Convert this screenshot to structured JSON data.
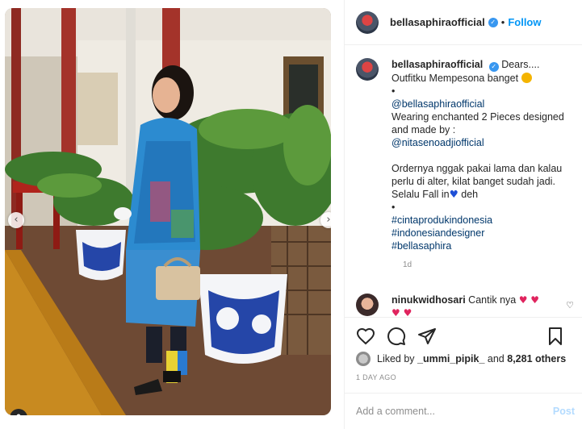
{
  "post": {
    "username": "bellasaphiraofficial",
    "follow_label": "Follow",
    "separator": "•"
  },
  "caption": {
    "username": "bellasaphiraofficial",
    "line1": "Dears....",
    "line2": "Outfitku Mempesona banget",
    "bullet1": "•",
    "mention1": "@bellasaphiraofficial",
    "line3": "Wearing enchanted 2 Pieces designed",
    "line4": "and made by :",
    "mention2": "@nitasenoadjiofficial",
    "line5": "Ordernya nggak pakai lama dan kalau",
    "line6": "perlu di alter, kilat banget sudah jadi.",
    "line7a": "Selalu Fall in",
    "line7b": " deh",
    "bullet2": "•",
    "hashtag1": "#cintaprodukindonesia",
    "hashtag2": "#indonesiandesigner",
    "hashtag3": "#bellasaphira",
    "time_ago": "1d"
  },
  "comment": {
    "username": "ninukwidhosari",
    "text": "Cantik nya"
  },
  "likes": {
    "prefix": "Liked by",
    "liker": "_ummi_pipik_",
    "middle": "and",
    "count": "8,281 others"
  },
  "posted_date": "1 DAY AGO",
  "comment_box": {
    "placeholder": "Add a comment...",
    "post_label": "Post"
  },
  "icons": {
    "verified": "verified-badge-icon",
    "heart": "heart-icon",
    "comment": "comment-icon",
    "share": "share-icon",
    "save": "bookmark-icon",
    "arrow_left": "chevron-left-icon",
    "arrow_right": "chevron-right-icon",
    "tag": "user-tag-icon"
  },
  "colors": {
    "accent": "#0095f6",
    "link": "#00376b",
    "muted": "#8e8e8e",
    "heart_red": "#e0245e",
    "heart_blue": "#1e4fd6"
  }
}
